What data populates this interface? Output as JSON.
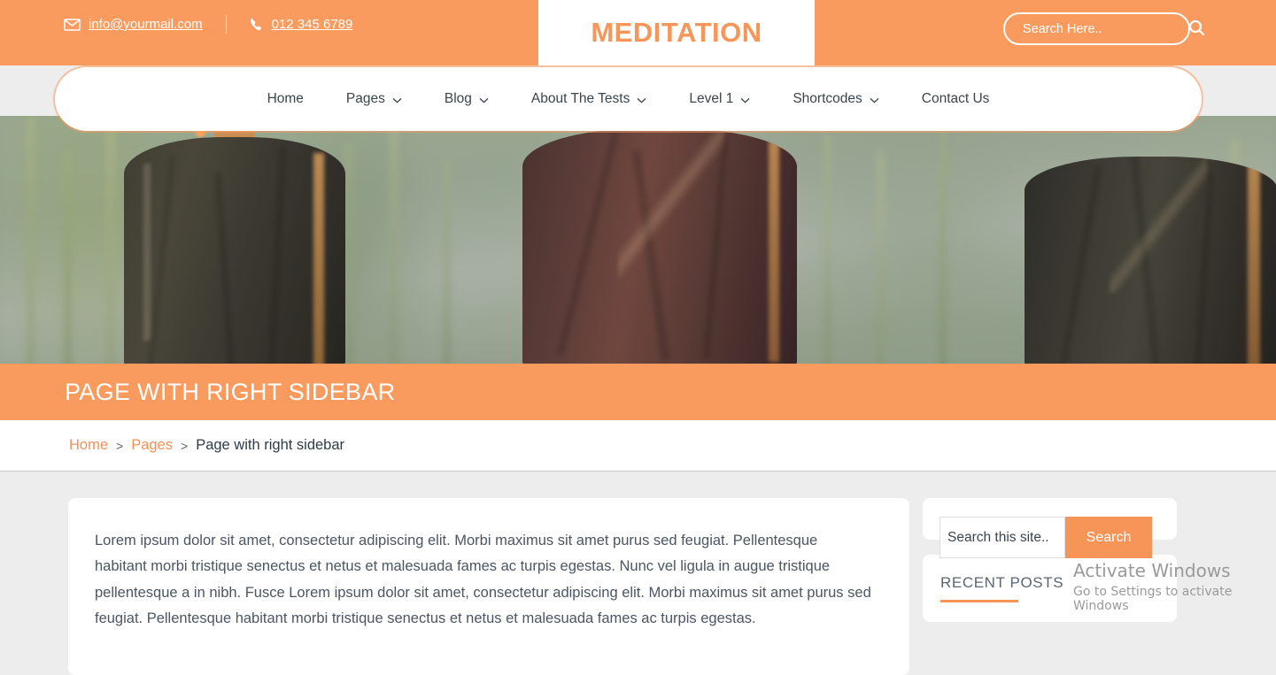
{
  "brand": {
    "logo_text": "MEDITATION",
    "accent_color": "#f99b5e",
    "accent_dark": "#f79457"
  },
  "topbar": {
    "email": "info@yourmail.com",
    "phone": "012 345 6789",
    "email_icon": "envelope-icon",
    "phone_icon": "phone-icon"
  },
  "header_search": {
    "placeholder": "Search Here..",
    "value": "",
    "icon": "search-icon"
  },
  "nav": {
    "items": [
      {
        "label": "Home",
        "has_dropdown": false
      },
      {
        "label": "Pages",
        "has_dropdown": true
      },
      {
        "label": "Blog",
        "has_dropdown": true
      },
      {
        "label": "About The Tests",
        "has_dropdown": true
      },
      {
        "label": "Level 1",
        "has_dropdown": true
      },
      {
        "label": "Shortcodes",
        "has_dropdown": true
      },
      {
        "label": "Contact Us",
        "has_dropdown": false
      }
    ],
    "dropdown_icon": "chevron-down-icon"
  },
  "hero": {
    "alt": "Three monks in robes seen from behind facing blurred green foliage"
  },
  "page_title": "PAGE WITH RIGHT SIDEBAR",
  "breadcrumb": {
    "items": [
      {
        "label": "Home",
        "is_link": true
      },
      {
        "label": "Pages",
        "is_link": true
      },
      {
        "label": "Page with right sidebar",
        "is_link": false
      }
    ],
    "separator": ">"
  },
  "main": {
    "paragraph": "Lorem ipsum dolor sit amet, consectetur adipiscing elit. Morbi maximus sit amet purus sed feugiat. Pellentesque habitant morbi tristique senectus et netus et malesuada fames ac turpis egestas. Nunc vel ligula in augue tristique pellentesque a in nibh. Fusce Lorem ipsum dolor sit amet, consectetur adipiscing elit. Morbi maximus sit amet purus sed feugiat. Pellentesque habitant morbi tristique senectus et netus et malesuada fames ac turpis egestas."
  },
  "sidebar": {
    "search": {
      "placeholder": "Search this site..",
      "value": "",
      "button_label": "Search"
    },
    "recent_posts": {
      "title": "RECENT POSTS"
    }
  },
  "watermark": {
    "title": "Activate Windows",
    "subtitle": "Go to Settings to activate Windows"
  }
}
